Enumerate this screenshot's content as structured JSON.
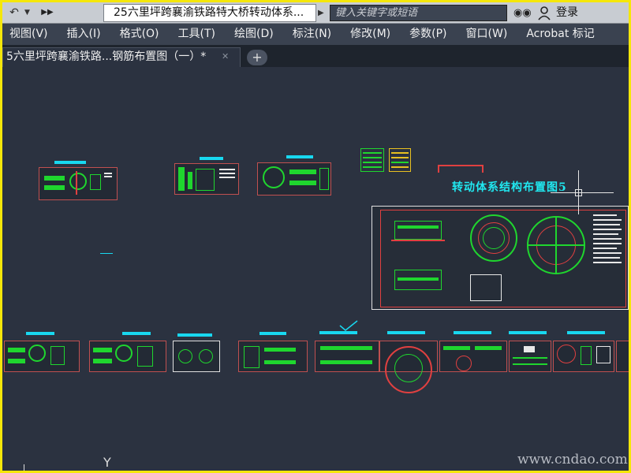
{
  "app": {
    "document_title": "25六里坪跨襄渝铁路特大桥转动体系...",
    "search_placeholder": "键入关键字或短语",
    "login_label": "登录"
  },
  "menu": {
    "items": [
      "视图(V)",
      "插入(I)",
      "格式(O)",
      "工具(T)",
      "绘图(D)",
      "标注(N)",
      "修改(M)",
      "参数(P)",
      "窗口(W)",
      "Acrobat 标记"
    ]
  },
  "tabs": {
    "active_label": "5六里坪跨襄渝铁路...钢筋布置图（一）*",
    "close_glyph": "✕",
    "new_glyph": "+"
  },
  "drawing": {
    "main_title": "转动体系结构布置图5",
    "watermark": "www.cndao.com",
    "ucs_label": "Y"
  },
  "colors": {
    "background": "#2b3240",
    "accent_cyan": "#18d8f0",
    "line_green": "#1fd62e",
    "line_red": "#e04040",
    "frame_yellow": "#f5e70a"
  },
  "icons": [
    "back-arrow-icon",
    "dropdown-icon",
    "more-icon",
    "binoculars-icon",
    "user-icon",
    "crosshair-cursor-icon",
    "ucs-icon"
  ]
}
